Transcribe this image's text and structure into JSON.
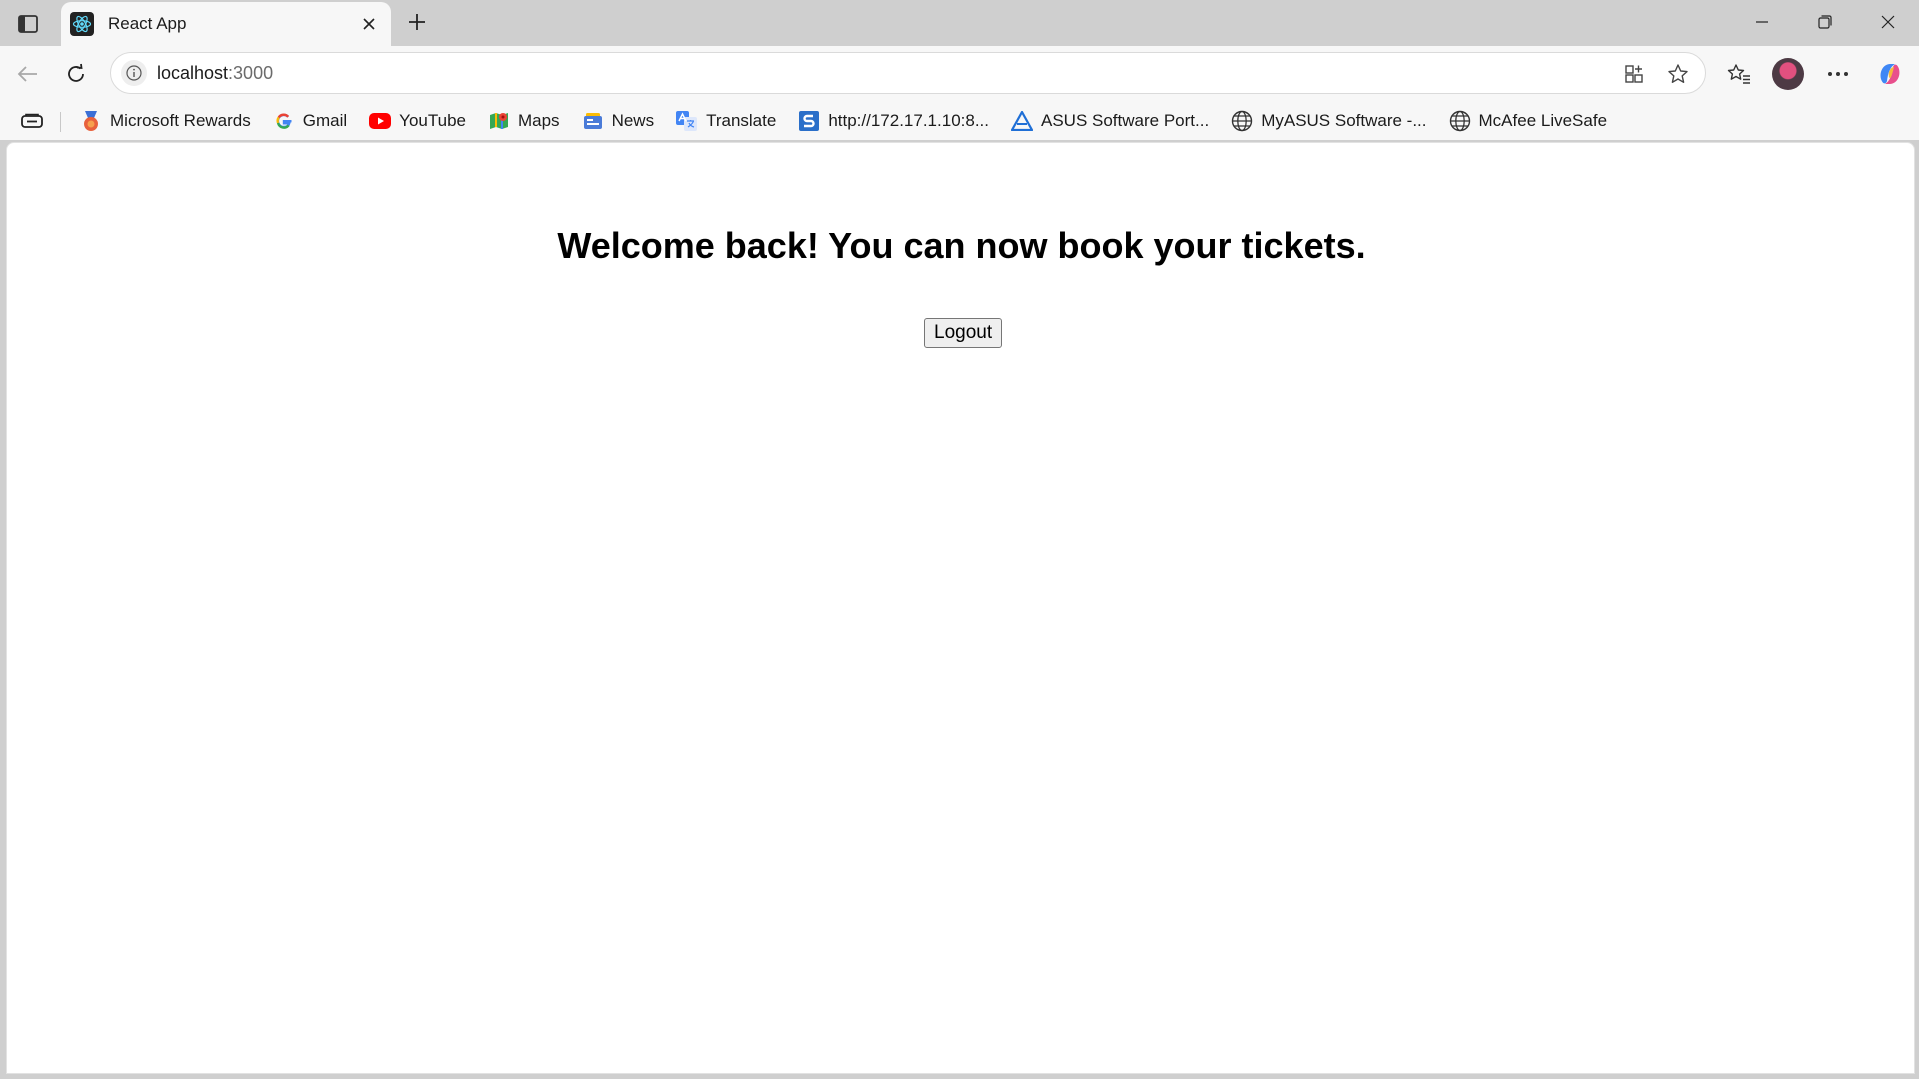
{
  "browser": {
    "tab": {
      "title": "React App",
      "favicon": "react-icon"
    },
    "address_bar": {
      "host": "localhost",
      "port": ":3000"
    },
    "bookmarks": [
      {
        "label": "Microsoft Rewards",
        "icon": "rewards-icon",
        "color": "#d9483b"
      },
      {
        "label": "Gmail",
        "icon": "google-icon",
        "color": "#4285f4"
      },
      {
        "label": "YouTube",
        "icon": "youtube-icon",
        "color": "#ff0000"
      },
      {
        "label": "Maps",
        "icon": "maps-icon",
        "color": "#34a853"
      },
      {
        "label": "News",
        "icon": "news-icon",
        "color": "#4a7bd8"
      },
      {
        "label": "Translate",
        "icon": "translate-icon",
        "color": "#4285f4"
      },
      {
        "label": "http://172.17.1.10:8...",
        "icon": "s-icon",
        "color": "#2a6fc9"
      },
      {
        "label": "ASUS Software Port...",
        "icon": "asus-icon",
        "color": "#1f6fd6"
      },
      {
        "label": "MyASUS Software -...",
        "icon": "globe-icon",
        "color": "#333333"
      },
      {
        "label": "McAfee LiveSafe",
        "icon": "globe-icon",
        "color": "#333333"
      }
    ]
  },
  "page": {
    "heading": "Welcome back! You can now book your tickets.",
    "logout_label": "Logout"
  }
}
